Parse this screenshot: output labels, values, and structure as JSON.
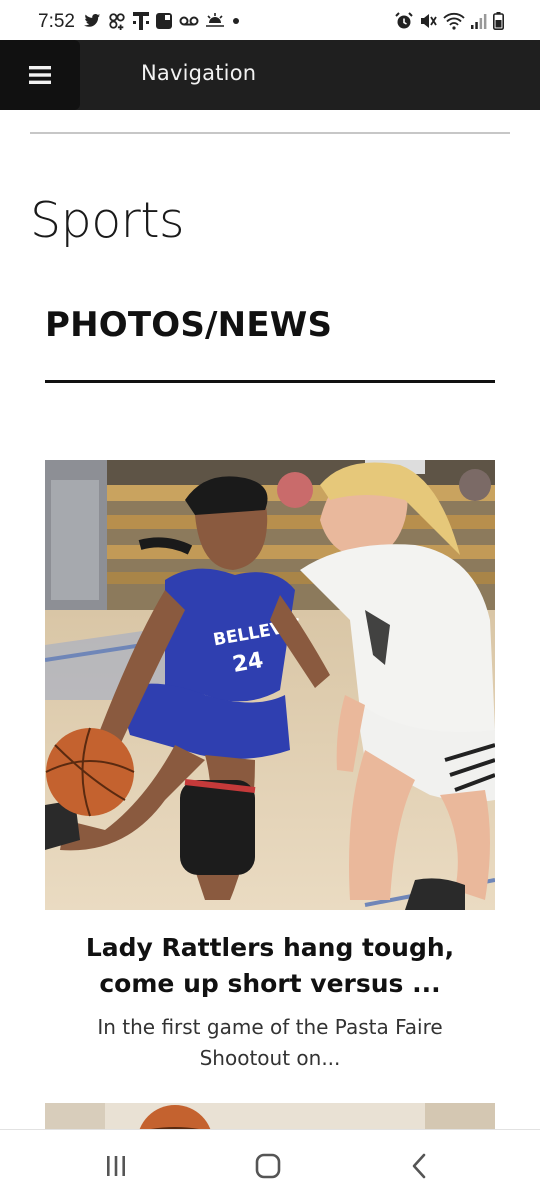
{
  "status_bar": {
    "time": "7:52",
    "left_icons": [
      "twitter-icon",
      "pinwheel-icon",
      "t-mobile-icon",
      "square-app-icon",
      "voicemail-icon",
      "weather-sunrise-icon",
      "dot-icon"
    ],
    "right_icons": [
      "alarm-icon",
      "mute-icon",
      "wifi-icon",
      "signal-icon",
      "battery-icon"
    ]
  },
  "nav": {
    "menu_icon": "hamburger-icon",
    "title": "Navigation"
  },
  "page": {
    "title": "Sports",
    "section_heading": "PHOTOS/NEWS"
  },
  "article": {
    "jersey_text": "BELLEVIE",
    "jersey_number": "24",
    "headline": "Lady Rattlers hang tough, come up short versus ...",
    "excerpt": "In the first game of the Pasta Faire Shootout on..."
  },
  "system_nav": {
    "icons": [
      "recent-apps-icon",
      "home-icon",
      "back-icon"
    ]
  },
  "colors": {
    "nav_background": "#1f1f1f",
    "menu_button": "#111111",
    "jersey_blue": "#2f3fb0"
  }
}
